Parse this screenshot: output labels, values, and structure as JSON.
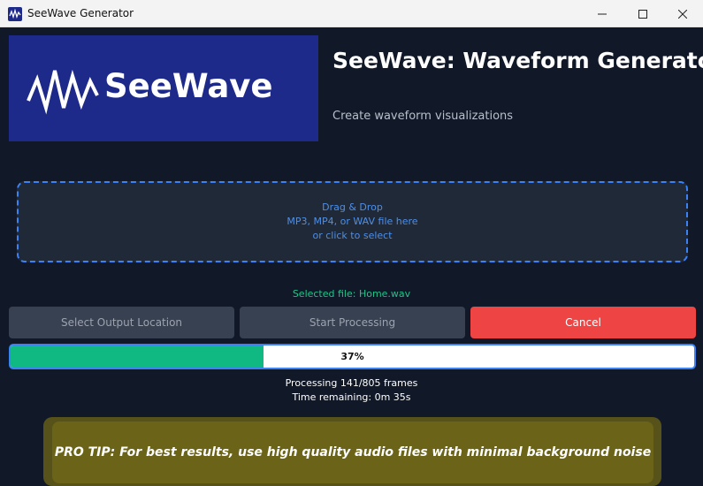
{
  "window": {
    "title": "SeeWave Generator",
    "icon": "waveform-icon",
    "controls": [
      "minimize-icon",
      "maximize-icon",
      "close-icon"
    ]
  },
  "logo": {
    "text": "SeeWave",
    "icon": "waveform-icon",
    "background": "#1e2a8a"
  },
  "header": {
    "title": "SeeWave: Waveform Generator",
    "subtitle": "Create waveform visualizations"
  },
  "dropzone": {
    "line1": "Drag & Drop",
    "line2": "MP3, MP4, or WAV file here",
    "line3": "or click to select",
    "border_color": "#3b82f6"
  },
  "selected_file": "Selected file: Home.wav",
  "buttons": {
    "select_output": "Select Output Location",
    "start_processing": "Start Processing",
    "cancel": "Cancel"
  },
  "progress": {
    "percent": 37,
    "label": "37%",
    "color": "#10b981"
  },
  "status": {
    "frames": "Processing 141/805 frames",
    "remaining": "Time remaining: 0m 35s"
  },
  "tip": {
    "text": "PRO TIP: For best results, use high quality audio files with minimal background noise"
  },
  "colors": {
    "background": "#111827",
    "accent": "#3b82f6",
    "success": "#22c48a",
    "danger": "#ef4444"
  }
}
